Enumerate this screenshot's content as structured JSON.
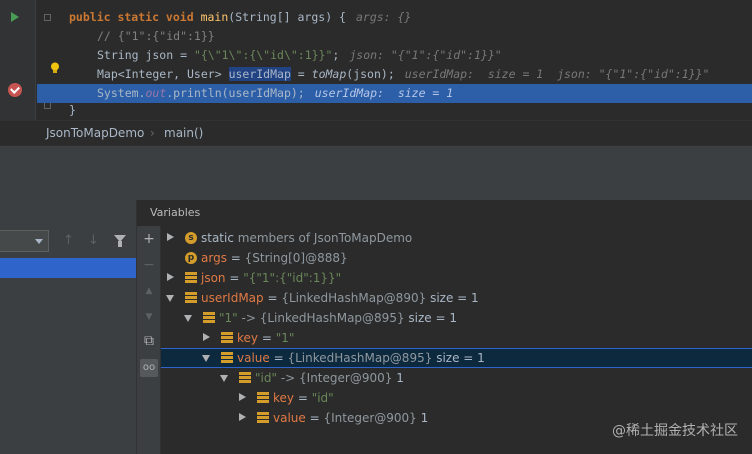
{
  "editor": {
    "lines": [
      {
        "kw1": "public static void",
        "fn": "main",
        "rest": "(String[] args) {",
        "hint": "args: {}"
      },
      {
        "comment": "// {\"1\":{\"id\":1}}"
      },
      {
        "pre": "String json = ",
        "str": "\"{\\\"1\\\":{\\\"id\\\":1}}\"",
        "post": ";",
        "hint": "json: \"{\"1\":{\"id\":1}}\""
      },
      {
        "pre": "Map<Integer, User> ",
        "var": "userIdMap",
        "mid": " = ",
        "call": "toMap",
        "post": "(json);",
        "hint": "userIdMap:  size = 1  json: \"{\"1\":{\"id\":1}}\""
      },
      {
        "pre": "System.",
        "field": "out",
        "post": ".println(userIdMap);",
        "hint": "userIdMap:  size = 1"
      },
      {
        "text": "}"
      }
    ]
  },
  "breadcrumbs": {
    "class_name": "JsonToMapDemo",
    "separator": "›",
    "method": "main()"
  },
  "debugger": {
    "variables_title": "Variables",
    "toolbar": {
      "add": "+",
      "minus": "−",
      "up": "▲",
      "down": "▼",
      "copy": "⧉",
      "watch": "oo"
    },
    "nav": {
      "up": "↑",
      "down": "↓"
    },
    "vars": [
      {
        "name": "static",
        "value": " members of JsonToMapDemo"
      },
      {
        "name": "args",
        "eq": " = ",
        "value": "{String[0]@888}"
      },
      {
        "name": "json",
        "eq": " = ",
        "value": "\"{\"1\":{\"id\":1}}\""
      },
      {
        "name": "userIdMap",
        "eq": " = ",
        "value": "{LinkedHashMap@890}",
        "size": "size = 1"
      },
      {
        "name": "\"1\"",
        "eq": " -> ",
        "value": "{LinkedHashMap@895}",
        "size": "size = 1"
      },
      {
        "name": "key",
        "eq": " = ",
        "value": "\"1\""
      },
      {
        "name": "value",
        "eq": " = ",
        "value": "{LinkedHashMap@895}",
        "size": "size = 1"
      },
      {
        "name": "\"id\"",
        "eq": " -> ",
        "value": "{Integer@900}",
        "size": "1"
      },
      {
        "name": "key",
        "eq": " = ",
        "value": "\"id\""
      },
      {
        "name": "value",
        "eq": " = ",
        "value": "{Integer@900}",
        "size": "1"
      }
    ],
    "static_badge": "s",
    "args_badge": "p"
  },
  "watermark": "@稀土掘金技术社区",
  "colors": {
    "accent": "#2f65ca",
    "exec_line": "#2d5fa8",
    "selected_row": "#0d293e"
  }
}
